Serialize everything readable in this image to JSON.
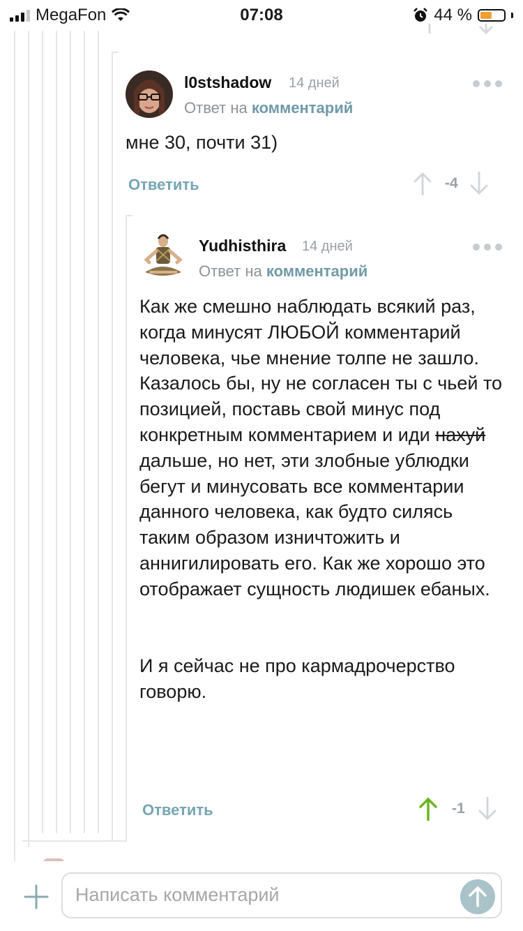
{
  "status_bar": {
    "carrier": "MegaFon",
    "time": "07:08",
    "battery_percent": "44 %"
  },
  "comments": [
    {
      "username": "l0stshadow",
      "time": "14 дней",
      "reply_prefix": "Ответ на",
      "reply_link": "комментарий",
      "paragraphs": [
        "мне 30, почти 31)"
      ],
      "reply_label": "Ответить",
      "rating": "-4"
    },
    {
      "username": "Yudhisthira",
      "time": "14 дней",
      "reply_prefix": "Ответ на",
      "reply_link": "комментарий",
      "paragraph1": "Как же смешно наблюдать всякий раз, когда минусят ЛЮБОЙ комментарий человека, чье мнение толпе не зашло.",
      "paragraph2_a": "Казалось бы, ну не согласен ты с чьей то позицией, поставь свой минус под конкретным комментарием и иди",
      "paragraph2_strike": "нахуй",
      "paragraph2_b": "дальше, но нет, эти злобные ублюдки бегут и минусовать все комментарии данного человека, как будто силясь таким образом изничтожить и аннигилировать его. Как же хорошо это отображает сущность людишек ебаных.",
      "paragraph3": "И я сейчас не про кармадрочерство говорю.",
      "reply_label": "Ответить",
      "rating": "-1"
    }
  ],
  "composer": {
    "placeholder": "Написать комментарий"
  },
  "colors": {
    "accent": "#74a6b1",
    "upvote_active": "#6bb324",
    "muted": "#9aa0a6",
    "battery": "#f0a030"
  }
}
